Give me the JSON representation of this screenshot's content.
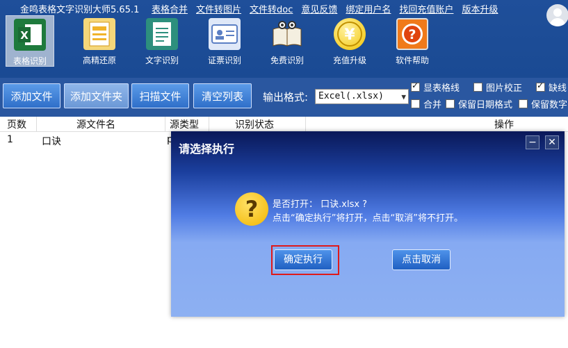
{
  "app": {
    "title": "金鸣表格文字识别大师5.65.1"
  },
  "top_menu": [
    "表格合并",
    "文件转图片",
    "文件转doc",
    "意见反馈",
    "绑定用户名",
    "找回充值账户",
    "版本升级"
  ],
  "tools": [
    {
      "label": "表格识别",
      "icon": "excel-icon",
      "color": "#1e7a3c"
    },
    {
      "label": "高精还原",
      "icon": "document-restore-icon",
      "color": "#f5d77a"
    },
    {
      "label": "文字识别",
      "icon": "text-doc-icon",
      "color": "#2d8f7d"
    },
    {
      "label": "证票识别",
      "icon": "id-card-icon",
      "color": "#9fb7e6"
    },
    {
      "label": "免费识别",
      "icon": "book-icon",
      "color": "#c9b27a"
    },
    {
      "label": "充值升级",
      "icon": "yuan-coin-icon",
      "color": "#f2c200"
    },
    {
      "label": "软件帮助",
      "icon": "help-icon",
      "color": "#f07a1a"
    }
  ],
  "toolbar": {
    "add_file": "添加文件",
    "add_folder": "添加文件夹",
    "scan_file": "扫描文件",
    "clear_list": "清空列表",
    "output_label": "输出格式:",
    "output_value": "Excel(.xlsx)",
    "checks": [
      {
        "label": "显表格线",
        "checked": true
      },
      {
        "label": "图片校正",
        "checked": false
      },
      {
        "label": "缺线",
        "checked": true
      },
      {
        "label": "合并",
        "checked": false
      },
      {
        "label": "保留日期格式",
        "checked": false
      },
      {
        "label": "保留数字",
        "checked": false
      }
    ]
  },
  "table": {
    "headers": [
      "页数",
      "源文件名",
      "源类型",
      "识别状态",
      "操作"
    ],
    "rows": [
      {
        "pages": "1",
        "name": "口诀",
        "type": "p"
      }
    ]
  },
  "dialog": {
    "title": "请选择执行",
    "line1": "是否打开： 口诀.xlsx ?",
    "line2": "点击“确定执行”将打开，点击“取消”将不打开。",
    "confirm": "确定执行",
    "cancel": "点击取消",
    "minimize": "−",
    "close": "✕"
  }
}
